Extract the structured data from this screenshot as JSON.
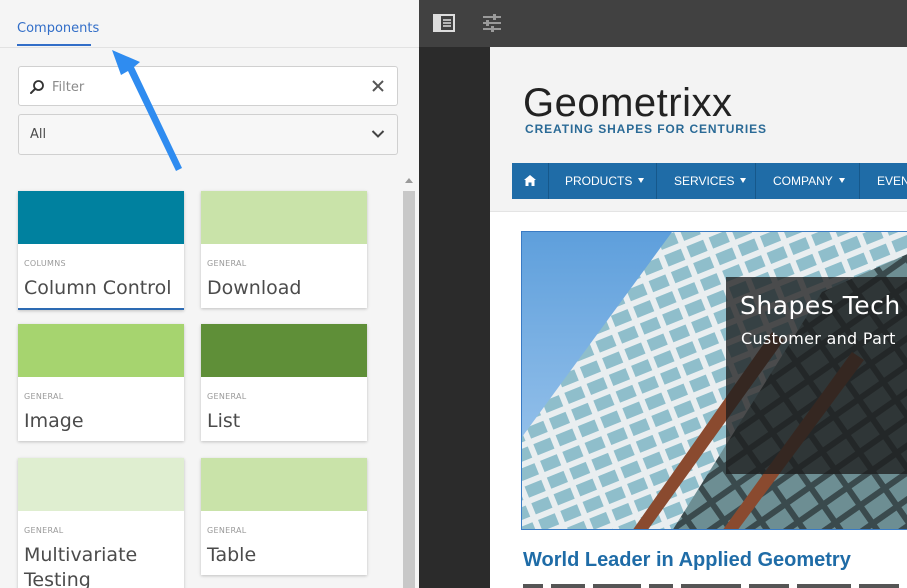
{
  "left_panel": {
    "tab": {
      "label": "Components"
    },
    "filter": {
      "placeholder": "Filter",
      "value": ""
    },
    "group_select": {
      "value": "All"
    },
    "cards": [
      {
        "category": "COLUMNS",
        "title": "Column Control",
        "color": "#00819f",
        "selected": true
      },
      {
        "category": "GENERAL",
        "title": "Download",
        "color": "#c9e3a9"
      },
      {
        "category": "GENERAL",
        "title": "Image",
        "color": "#a6d46f"
      },
      {
        "category": "GENERAL",
        "title": "List",
        "color": "#5f8f38"
      },
      {
        "category": "GENERAL",
        "title": "Multivariate Testing",
        "color": "#dfeed0"
      },
      {
        "category": "GENERAL",
        "title": "Table",
        "color": "#c9e3a9"
      }
    ]
  },
  "editor": {
    "toolbar": {
      "icons": [
        "toggle-side-panel-icon",
        "page-properties-icon"
      ]
    },
    "page": {
      "logo": "Geometrixx",
      "tagline": "CREATING SHAPES FOR CENTURIES",
      "nav": {
        "home_icon": "home-icon",
        "items": [
          {
            "label": "PRODUCTS"
          },
          {
            "label": "SERVICES"
          },
          {
            "label": "COMPANY"
          },
          {
            "label": "EVEN"
          }
        ]
      },
      "hero": {
        "title": "Shapes Tech",
        "subtitle": "Customer and Part"
      },
      "article_title": "World Leader in Applied Geometry"
    }
  },
  "colors": {
    "accent_blue": "#326ec8",
    "nav_blue": "#1f6ca7",
    "toolbar": "#414141",
    "arrow": "#2f8cf0"
  }
}
